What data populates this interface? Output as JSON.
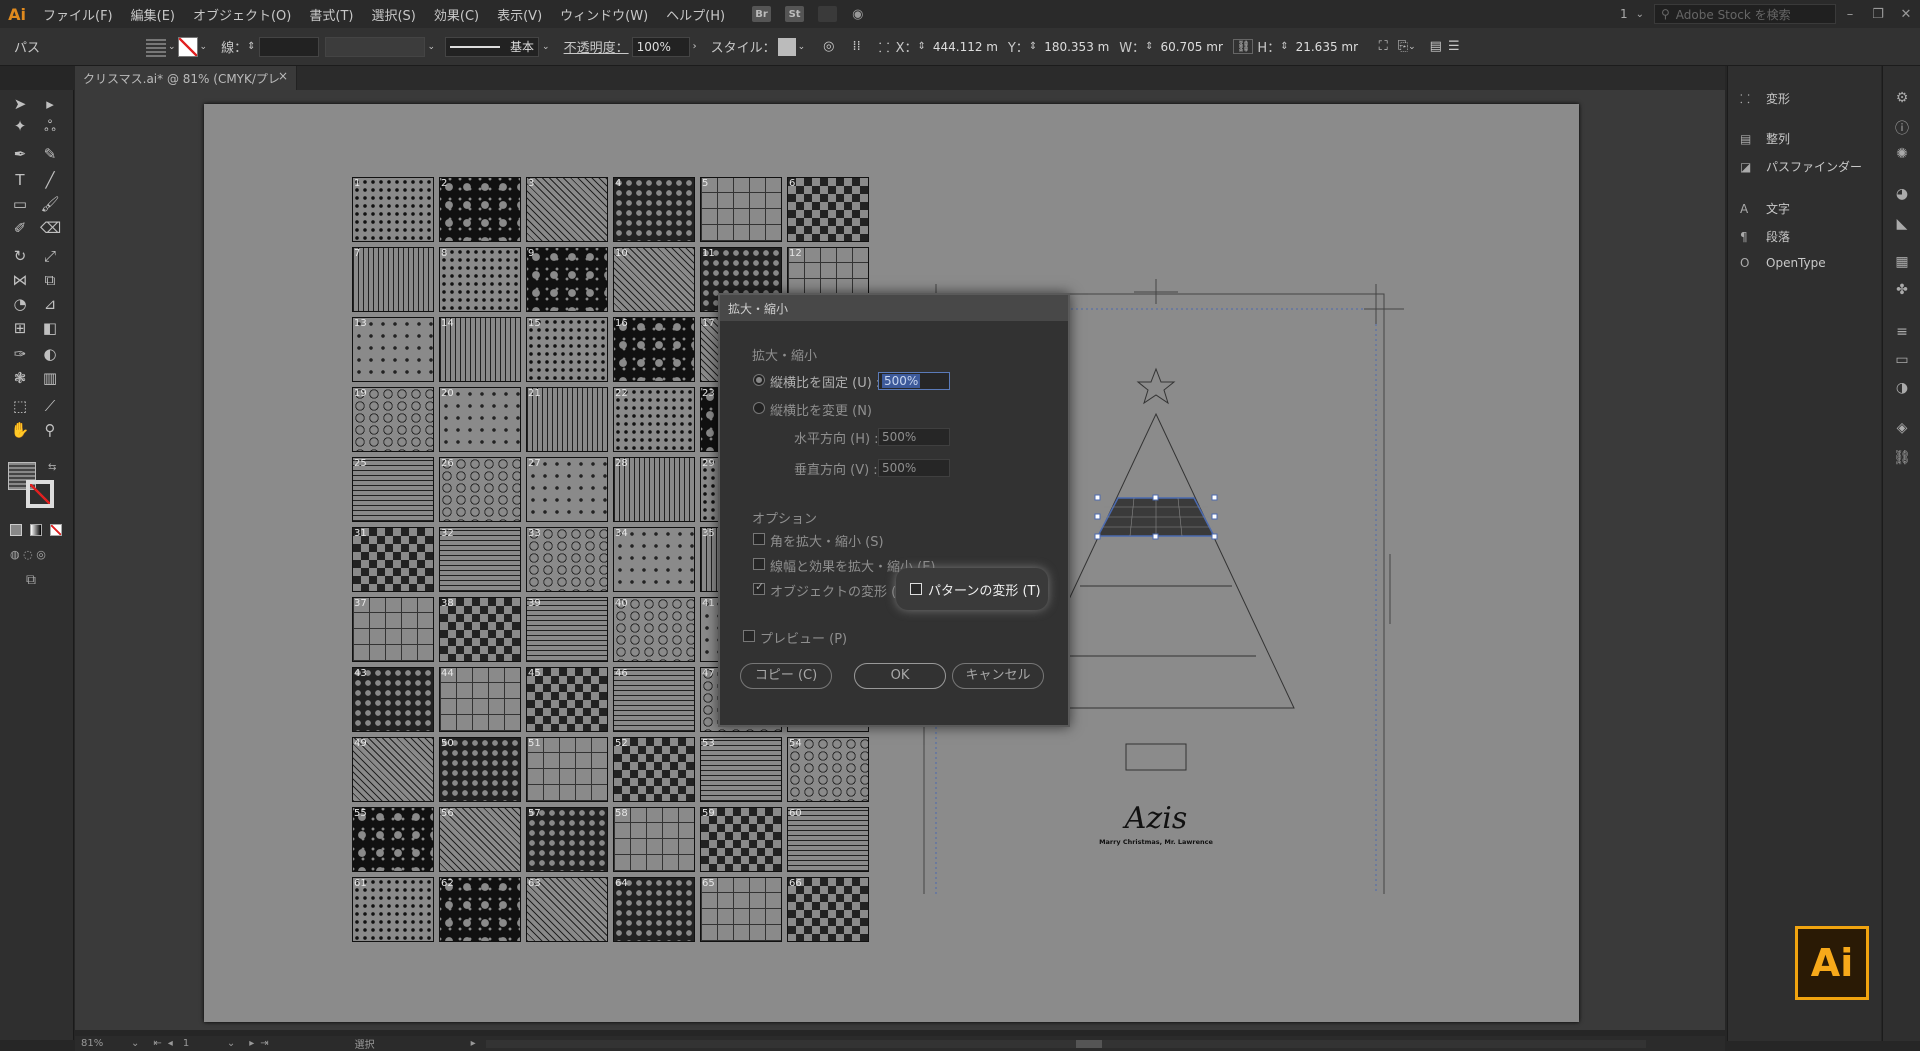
{
  "menubar": {
    "logo": "Ai",
    "items": [
      "ファイル(F)",
      "編集(E)",
      "オブジェクト(O)",
      "書式(T)",
      "選択(S)",
      "効果(C)",
      "表示(V)",
      "ウィンドウ(W)",
      "ヘルプ(H)"
    ],
    "bridge_label": "Br",
    "stock_label": "St",
    "workspace_label": "1",
    "search_placeholder": "Adobe Stock を検索"
  },
  "control": {
    "object_type": "パス",
    "stroke_label": "線：",
    "stroke_style": "基本",
    "opacity_label": "不透明度：",
    "opacity_value": "100%",
    "style_label": "スタイル：",
    "x_label": "X：",
    "x_value": "444.112 m",
    "y_label": "Y：",
    "y_value": "180.353 m",
    "w_label": "W：",
    "w_value": "60.705 mr",
    "h_label": "H：",
    "h_value": "21.635 mr"
  },
  "document": {
    "tab_title": "クリスマス.ai* @ 81% (CMYK/プレビュー)",
    "close": "×"
  },
  "patterns": {
    "numbers": [
      "1",
      "2",
      "3",
      "4",
      "5",
      "6",
      "7",
      "8",
      "9",
      "10",
      "11",
      "12",
      "13",
      "14",
      "15",
      "16",
      "17",
      "",
      "19",
      "20",
      "21",
      "22",
      "23",
      "",
      "25",
      "26",
      "27",
      "28",
      "29",
      "",
      "31",
      "32",
      "33",
      "34",
      "35",
      "",
      "37",
      "38",
      "39",
      "40",
      "41",
      "",
      "43",
      "44",
      "45",
      "46",
      "47",
      "",
      "49",
      "50",
      "51",
      "52",
      "53",
      "54",
      "55",
      "56",
      "57",
      "58",
      "59",
      "60",
      "61",
      "62",
      "63",
      "64",
      "65",
      "66"
    ]
  },
  "artwork": {
    "title": "Azis",
    "subtitle": "Marry Christmas, Mr. Lawrence"
  },
  "dialog": {
    "title": "拡大・縮小",
    "scale_section": "拡大・縮小",
    "uniform_label": "縦横比を固定 (U) :",
    "uniform_value": "500%",
    "non_uniform_label": "縦横比を変更 (N)",
    "horizontal_label": "水平方向 (H) :",
    "horizontal_value": "500%",
    "vertical_label": "垂直方向 (V) :",
    "vertical_value": "500%",
    "options_section": "オプション",
    "scale_corners": "角を拡大・縮小 (S)",
    "scale_strokes": "線幅と効果を拡大・縮小 (E)",
    "transform_objects": "オブジェクトの変形 (O)",
    "transform_patterns": "パターンの変形 (T)",
    "preview": "プレビュー (P)",
    "copy_button": "コピー (C)",
    "ok_button": "OK",
    "cancel_button": "キャンセル"
  },
  "panels": {
    "transform": "変形",
    "align": "整列",
    "pathfinder": "パスファインダー",
    "character": "文字",
    "paragraph": "段落",
    "opentype": "OpenType"
  },
  "status": {
    "zoom": "81%",
    "page": "1",
    "tool": "選択"
  },
  "badge": "Ai"
}
